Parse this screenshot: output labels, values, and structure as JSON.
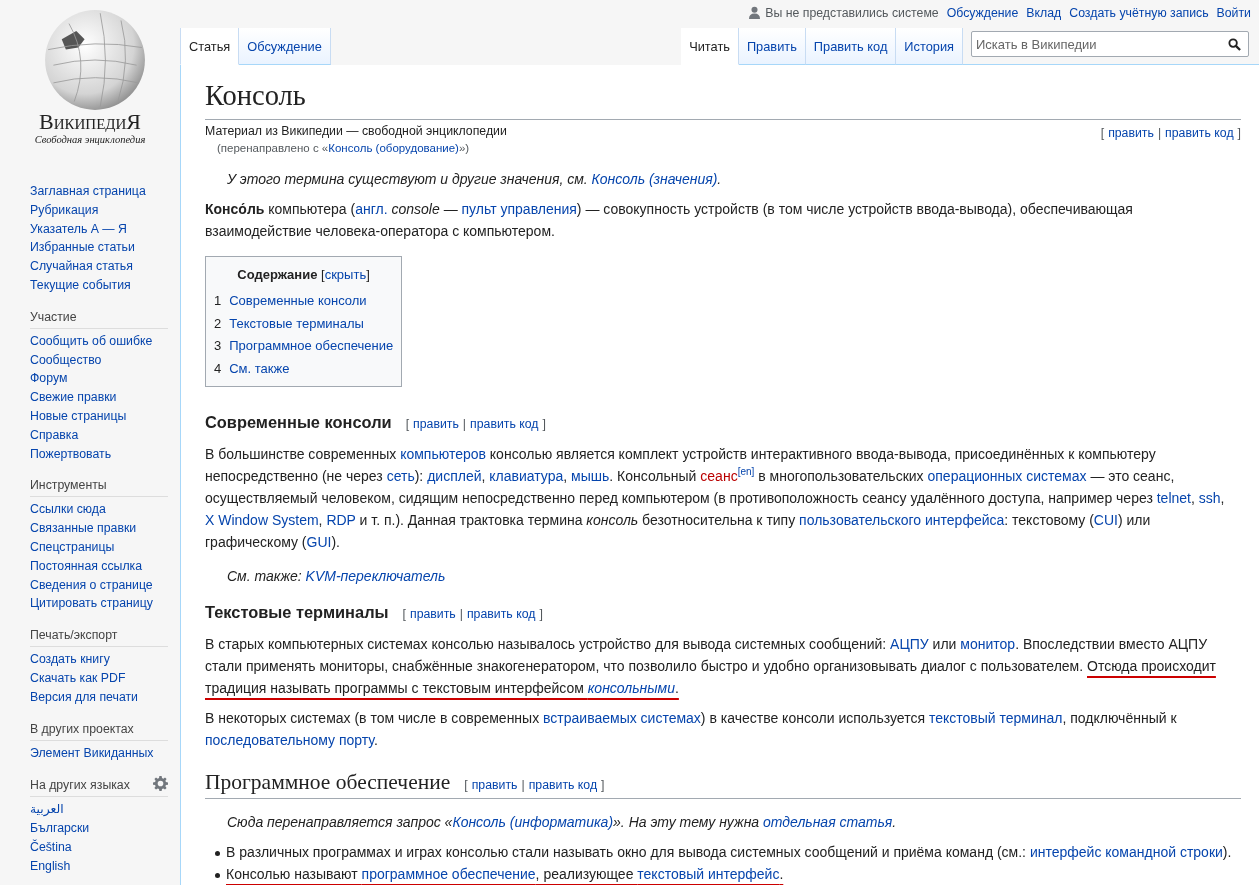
{
  "logo": {
    "title": "ВикипедиЯ",
    "tagline": "Свободная энциклопедия"
  },
  "personal": {
    "status": "Вы не представились системе",
    "links": [
      "Обсуждение",
      "Вклад",
      "Создать учётную запись",
      "Войти"
    ]
  },
  "tabs_left": [
    {
      "label": "Статья",
      "selected": true
    },
    {
      "label": "Обсуждение",
      "selected": false
    }
  ],
  "tabs_right": [
    {
      "label": "Читать",
      "selected": true
    },
    {
      "label": "Править",
      "selected": false
    },
    {
      "label": "Править код",
      "selected": false
    },
    {
      "label": "История",
      "selected": false
    }
  ],
  "search": {
    "placeholder": "Искать в Википедии"
  },
  "sidebar": {
    "main": [
      "Заглавная страница",
      "Рубрикация",
      "Указатель А — Я",
      "Избранные статьи",
      "Случайная статья",
      "Текущие события"
    ],
    "sections": [
      {
        "heading": "Участие",
        "settings": false,
        "items": [
          "Сообщить об ошибке",
          "Сообщество",
          "Форум",
          "Свежие правки",
          "Новые страницы",
          "Справка",
          "Пожертвовать"
        ]
      },
      {
        "heading": "Инструменты",
        "settings": false,
        "items": [
          "Ссылки сюда",
          "Связанные правки",
          "Спецстраницы",
          "Постоянная ссылка",
          "Сведения о странице",
          "Цитировать страницу"
        ]
      },
      {
        "heading": "Печать/экспорт",
        "settings": false,
        "items": [
          "Создать книгу",
          "Скачать как PDF",
          "Версия для печати"
        ]
      },
      {
        "heading": "В других проектах",
        "settings": false,
        "items": [
          "Элемент Викиданных"
        ]
      },
      {
        "heading": "На других языках",
        "settings": true,
        "items": [
          "العربية",
          "Български",
          "Čeština",
          "English"
        ]
      }
    ]
  },
  "article": {
    "title": "Консоль",
    "edit": {
      "open": "[",
      "links": [
        "править",
        "править код"
      ],
      "separator": "|",
      "close": "]"
    },
    "tagline": "Материал из Википедии — свободной энциклопедии",
    "redirect": [
      {
        "kind": "text",
        "text": "(перенаправлено с «"
      },
      {
        "kind": "link",
        "text": "Консоль (оборудование)"
      },
      {
        "kind": "text",
        "text": "»)"
      }
    ],
    "blocks": [
      {
        "kind": "hatnote",
        "segments": [
          {
            "kind": "text",
            "text": "У этого термина существуют и другие значения, см. "
          },
          {
            "kind": "link",
            "text": "Консоль (значения)"
          },
          {
            "kind": "text",
            "text": "."
          }
        ]
      },
      {
        "kind": "paragraph",
        "segments": [
          {
            "kind": "bold",
            "text": "Консо́ль"
          },
          {
            "kind": "text",
            "text": " компьютера ("
          },
          {
            "kind": "link",
            "text": "англ."
          },
          {
            "kind": "italic",
            "text": " console"
          },
          {
            "kind": "text",
            "text": " — "
          },
          {
            "kind": "link",
            "text": "пульт управления"
          },
          {
            "kind": "text",
            "text": ") — совокупность устройств (в том числе устройств ввода-вывода), обеспечивающая взаимодействие человека-оператора с компьютером."
          }
        ]
      },
      {
        "kind": "toc",
        "title": "Содержание",
        "toggle": {
          "open": "[",
          "label": "скрыть",
          "close": "]"
        },
        "items": [
          {
            "number": "1",
            "text": "Современные консоли"
          },
          {
            "number": "2",
            "text": "Текстовые терминалы"
          },
          {
            "number": "3",
            "text": "Программное обеспечение"
          },
          {
            "number": "4",
            "text": "См. также"
          }
        ]
      },
      {
        "kind": "subheading",
        "text": "Современные консоли",
        "edit": {
          "open": "[",
          "links": [
            "править",
            "править код"
          ],
          "separator": "|",
          "close": "]"
        }
      },
      {
        "kind": "paragraph",
        "segments": [
          {
            "kind": "text",
            "text": "В большинстве современных "
          },
          {
            "kind": "link",
            "text": "компьютеров"
          },
          {
            "kind": "text",
            "text": " консолью является комплект устройств интерактивного ввода-вывода, присоединённых к компьютеру непосредственно (не через "
          },
          {
            "kind": "link",
            "text": "сеть"
          },
          {
            "kind": "text",
            "text": "): "
          },
          {
            "kind": "link",
            "text": "дисплей"
          },
          {
            "kind": "text",
            "text": ", "
          },
          {
            "kind": "link",
            "text": "клавиатура"
          },
          {
            "kind": "text",
            "text": ", "
          },
          {
            "kind": "link",
            "text": "мышь"
          },
          {
            "kind": "text",
            "text": ". Консольный "
          },
          {
            "kind": "redlink",
            "text": "сеанс"
          },
          {
            "kind": "ref",
            "text": "[en]"
          },
          {
            "kind": "text",
            "text": " в многопользовательских "
          },
          {
            "kind": "link",
            "text": "операционных системах"
          },
          {
            "kind": "text",
            "text": " — это сеанс, осуществляемый человеком, сидящим непосредственно перед компьютером (в противоположность сеансу удалённого доступа, например через "
          },
          {
            "kind": "link",
            "text": "telnet"
          },
          {
            "kind": "text",
            "text": ", "
          },
          {
            "kind": "link",
            "text": "ssh"
          },
          {
            "kind": "text",
            "text": ", "
          },
          {
            "kind": "link",
            "text": "X Window System"
          },
          {
            "kind": "text",
            "text": ", "
          },
          {
            "kind": "link",
            "text": "RDP"
          },
          {
            "kind": "text",
            "text": " и т. п.). Данная трактовка термина "
          },
          {
            "kind": "italic",
            "text": "консоль"
          },
          {
            "kind": "text",
            "text": " безотносительна к типу "
          },
          {
            "kind": "link",
            "text": "пользовательского интерфейса"
          },
          {
            "kind": "text",
            "text": ": текстовому ("
          },
          {
            "kind": "link",
            "text": "CUI"
          },
          {
            "kind": "text",
            "text": ") или графическому ("
          },
          {
            "kind": "link",
            "text": "GUI"
          },
          {
            "kind": "text",
            "text": ")."
          }
        ]
      },
      {
        "kind": "hatnote",
        "segments": [
          {
            "kind": "text",
            "text": "См. также: "
          },
          {
            "kind": "link",
            "text": "KVM-переключатель"
          }
        ]
      },
      {
        "kind": "subheading",
        "text": "Текстовые терминалы",
        "edit": {
          "open": "[",
          "links": [
            "править",
            "править код"
          ],
          "separator": "|",
          "close": "]"
        }
      },
      {
        "kind": "paragraph",
        "segments": [
          {
            "kind": "text",
            "text": "В старых компьютерных системах консолью называлось устройство для вывода системных сообщений: "
          },
          {
            "kind": "link",
            "text": "АЦПУ"
          },
          {
            "kind": "text",
            "text": " или "
          },
          {
            "kind": "link",
            "text": "монитор"
          },
          {
            "kind": "text",
            "text": ". Впоследствии вместо АЦПУ стали применять мониторы, снабжённые знакогенератором, что позволило быстро и удобно организовывать диалог с пользователем. "
          }
        ],
        "underlined": [
          {
            "kind": "text",
            "text": "Отсюда происходит традиция называть программы с текстовым интерфейсом "
          },
          {
            "kind": "italiclink",
            "text": "консольными"
          },
          {
            "kind": "text",
            "text": "."
          }
        ]
      },
      {
        "kind": "paragraph",
        "segments": [
          {
            "kind": "text",
            "text": "В некоторых системах (в том числе в современных "
          },
          {
            "kind": "link",
            "text": "встраиваемых системах"
          },
          {
            "kind": "text",
            "text": ") в качестве консоли используется "
          },
          {
            "kind": "link",
            "text": "текстовый терминал"
          },
          {
            "kind": "text",
            "text": ", подключённый к "
          },
          {
            "kind": "link",
            "text": "последовательному порту"
          },
          {
            "kind": "text",
            "text": "."
          }
        ]
      },
      {
        "kind": "heading",
        "text": "Программное обеспечение",
        "edit": {
          "open": "[",
          "links": [
            "править",
            "править код"
          ],
          "separator": "|",
          "close": "]"
        }
      },
      {
        "kind": "hatnote",
        "segments": [
          {
            "kind": "text",
            "text": "Сюда перенаправляется запрос «"
          },
          {
            "kind": "link",
            "text": "Консоль (информатика)"
          },
          {
            "kind": "text",
            "text": "». На эту тему нужна "
          },
          {
            "kind": "link",
            "text": "отдельная статья"
          },
          {
            "kind": "text",
            "text": "."
          }
        ]
      },
      {
        "kind": "bullets",
        "items": [
          {
            "segments": [
              {
                "kind": "text",
                "text": "В различных программах и играх консолью стали называть окно для вывода системных сообщений и приёма команд (см.: "
              },
              {
                "kind": "link",
                "text": "интерфейс командной строки"
              },
              {
                "kind": "text",
                "text": ")."
              }
            ]
          },
          {
            "underlined": [
              {
                "kind": "text",
                "text": "Консолью называют "
              },
              {
                "kind": "link",
                "text": "программное обеспечение"
              },
              {
                "kind": "text",
                "text": ", реализующее "
              },
              {
                "kind": "link",
                "text": "текстовый интерфейс"
              },
              {
                "kind": "text",
                "text": "."
              }
            ]
          }
        ]
      }
    ]
  }
}
